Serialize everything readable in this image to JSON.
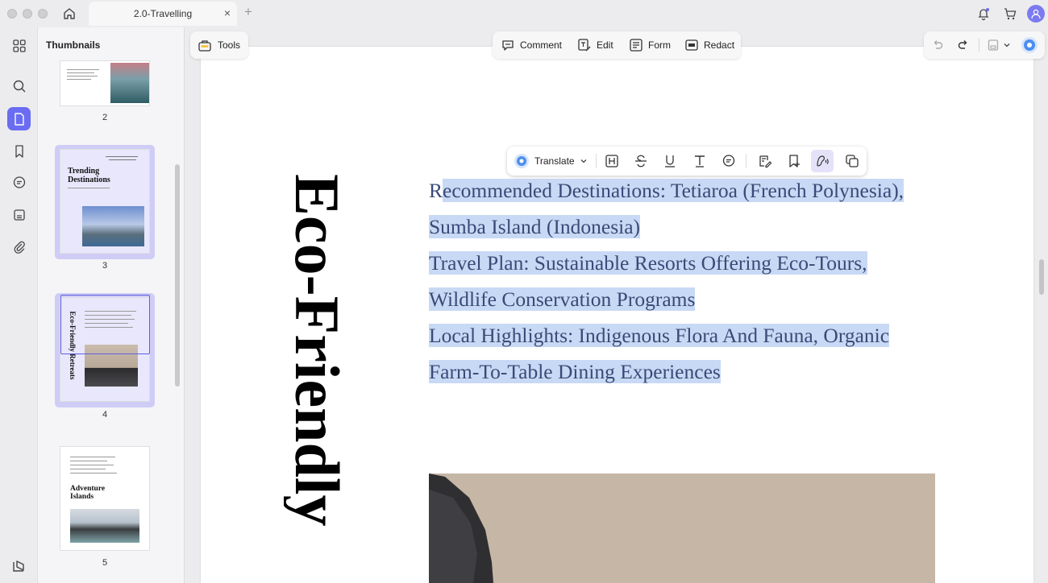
{
  "window": {
    "tab_title": "2.0-Travelling",
    "tab_close": "×",
    "tab_add": "+"
  },
  "sidebar": {
    "title": "Thumbnails"
  },
  "thumbnails": [
    {
      "page": "2",
      "title": ""
    },
    {
      "page": "3",
      "title": "Trending Destinations"
    },
    {
      "page": "4",
      "title": "Eco-Friendly Retreats"
    },
    {
      "page": "5",
      "title": "Adventure Islands"
    }
  ],
  "toolbar": {
    "tools": "Tools",
    "comment": "Comment",
    "edit": "Edit",
    "form": "Form",
    "redact": "Redact"
  },
  "floating_toolbar": {
    "translate": "Translate"
  },
  "document": {
    "vertical_title": "Eco-Friendly",
    "lines": [
      {
        "lead": "R",
        "text": "ecommended Destinations: Tetiaroa (French Polynesia), "
      },
      {
        "lead": "",
        "text": "Sumba Island (Indonesia)"
      },
      {
        "lead": "",
        "text": "Travel Plan: Sustainable Resorts Offering Eco-Tours, "
      },
      {
        "lead": "",
        "text": "Wildlife Conservation Programs"
      },
      {
        "lead": "",
        "text": "Local Highlights: Indigenous Flora And Fauna, Organic "
      },
      {
        "lead": "",
        "text": "Farm-To-Table Dining Experiences"
      }
    ]
  },
  "colors": {
    "accent": "#6a6cf2",
    "highlight": "#c8d9f5",
    "text": "#3a4a77"
  }
}
